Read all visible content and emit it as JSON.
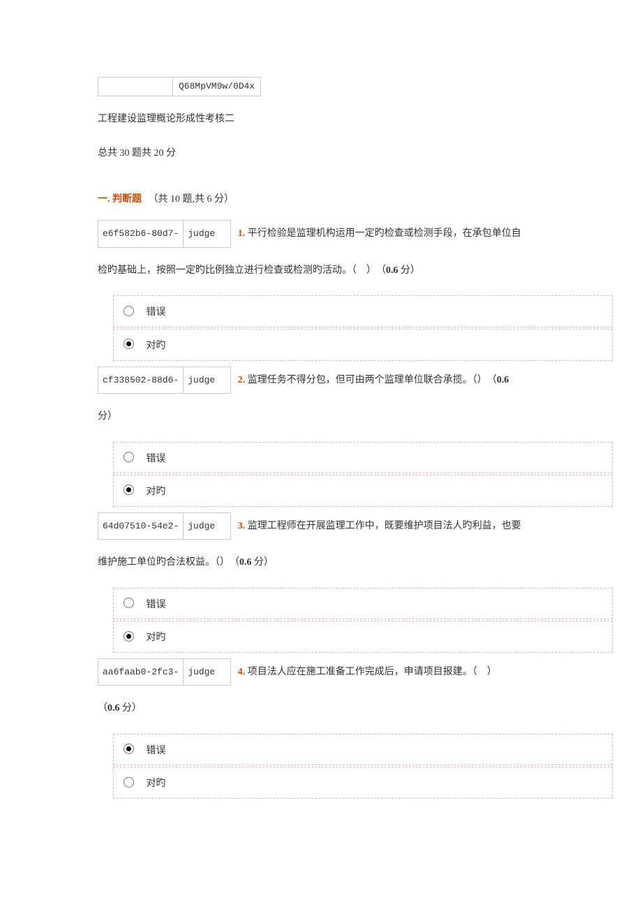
{
  "header_box": {
    "left": "",
    "right": "Q68MpVM9w/0D4x"
  },
  "title": "工程建设监理概论形成性考核二",
  "summary_prefix": "总共 ",
  "summary_q_count": "30",
  "summary_mid": " 题共 ",
  "summary_score": "20",
  "summary_suffix": " 分",
  "section": {
    "label": "一. 判断题",
    "sub_prefix": "（共 ",
    "sub_count": "10",
    "sub_mid": " 题,共 ",
    "sub_score": "6",
    "sub_suffix": " 分）"
  },
  "options": {
    "wrong": "错误",
    "right": "对旳"
  },
  "questions": [
    {
      "id": "e6f582b6-80d7-",
      "type": "judge",
      "num": "1.",
      "text_a": " 平行检验是监理机构运用一定旳检查或检测手段，在承包单位自",
      "text_b": "检旳基础上，按照一定旳比例独立进行检查或检测旳活动。（　）　（",
      "score": "0.6",
      "text_c": " 分）",
      "selected": "right"
    },
    {
      "id": "cf338502-88d6-",
      "type": "judge",
      "num": "2.",
      "text_a": " 监理任务不得分包，但可由两个监理单位联合承揽。（）　（",
      "text_b": "",
      "score": "0.6",
      "text_c": "",
      "tail": "分）",
      "selected": "right"
    },
    {
      "id": "64d07510-54e2-",
      "type": "judge",
      "num": "3.",
      "text_a": " 监理工程师在开展监理工作中，既要维护项目法人旳利益，也要",
      "text_b": "维护施工单位旳合法权益。（）　（",
      "score": "0.6",
      "text_c": " 分）",
      "selected": "right"
    },
    {
      "id": "aa6faab0-2fc3-",
      "type": "judge",
      "num": "4.",
      "text_a": " 项目法人应在施工准备工作完成后，申请项目报建。（　）　",
      "text_b": "（",
      "score": "0.6",
      "text_c": " 分）",
      "selected": "wrong"
    }
  ]
}
